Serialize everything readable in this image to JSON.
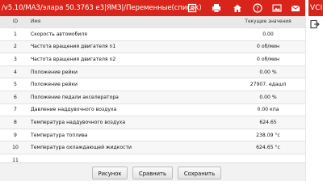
{
  "header": {
    "title": "/v5.10/МАЗ/элара 50.3763 е3|ЯМЗ|/Переменные(список)",
    "vci_label": "VCI",
    "icons": [
      "report-icon",
      "print-icon",
      "home-icon",
      "help-icon",
      "image-icon",
      "mail-icon"
    ]
  },
  "sidebar": {
    "icons": [
      "exit-icon"
    ]
  },
  "table": {
    "columns": [
      "ID",
      "Имя",
      "Текущие значения"
    ],
    "rows": [
      {
        "id": "1",
        "name": "Скорость автомобиля",
        "value": "0.00"
      },
      {
        "id": "2",
        "name": "Частота вращения двигателя n1",
        "value": "0 об/мин"
      },
      {
        "id": "3",
        "name": "Частота вращения двигателя n2",
        "value": "0 об/мин"
      },
      {
        "id": "4",
        "name": "Положение рейки",
        "value": "0.00 %"
      },
      {
        "id": "5",
        "name": "Положение рейки",
        "value": "27907. едашл"
      },
      {
        "id": "6",
        "name": "Положение педали акселератора",
        "value": "0.00 %"
      },
      {
        "id": "7",
        "name": "Давление наддувочного воздуха",
        "value": "0.00 кпа"
      },
      {
        "id": "8",
        "name": "Температура наддувочного воздуха",
        "value": "624.65"
      },
      {
        "id": "9",
        "name": "Температура топлива",
        "value": "238.09 °c"
      },
      {
        "id": "10",
        "name": "Температура охлаждающей жидкости",
        "value": "624.65 °c"
      },
      {
        "id": "11",
        "name": "",
        "value": ""
      }
    ]
  },
  "buttons": {
    "graph": "Рисунок",
    "compare": "Сравнить",
    "save": "Сохранить"
  }
}
